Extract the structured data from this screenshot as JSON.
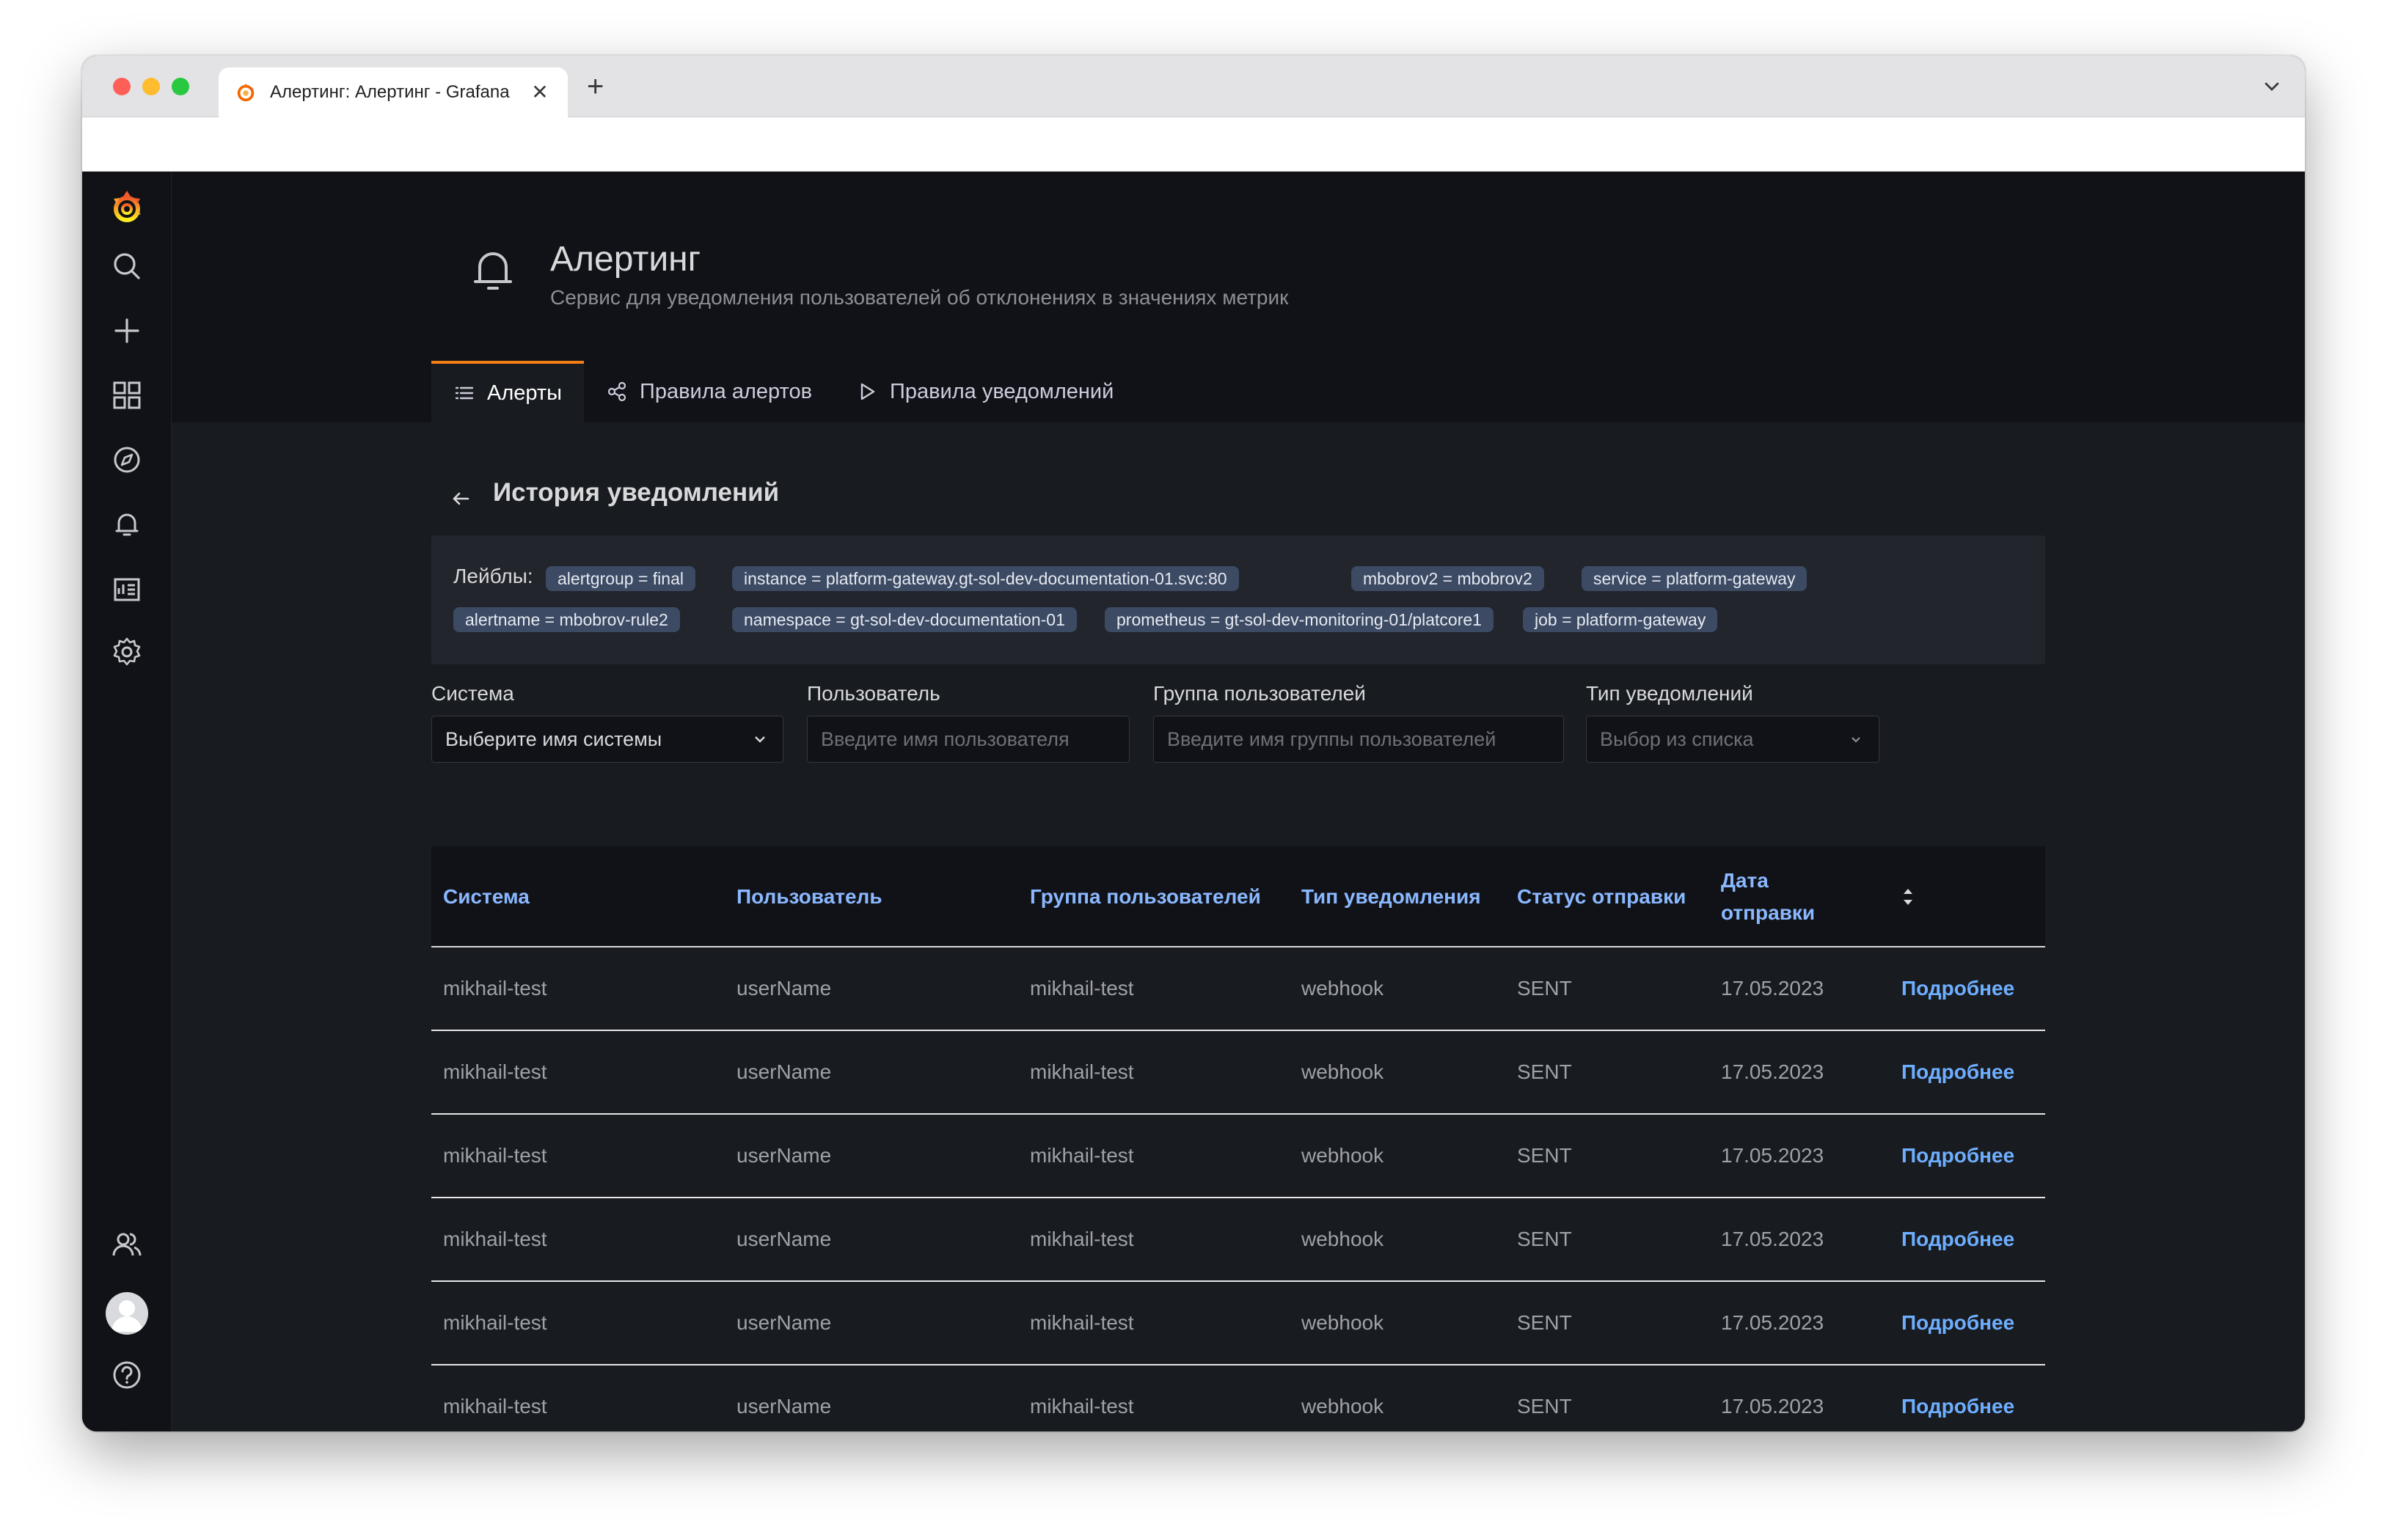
{
  "browser": {
    "tab_title": "Алертинг: Алертинг - Grafana",
    "close_glyph": "✕",
    "new_tab_glyph": "+"
  },
  "sidebar": {
    "icons": [
      "search-icon",
      "plus-icon",
      "dashboards-icon",
      "explore-icon",
      "alert-bell-icon",
      "reports-icon",
      "gear-icon",
      "users-icon",
      "avatar",
      "help-icon"
    ]
  },
  "header": {
    "title": "Алертинг",
    "subtitle": "Сервис для уведомления пользователей об отклонениях в значениях метрик"
  },
  "tabs": [
    {
      "label": "Алерты",
      "icon": "list-icon",
      "active": true
    },
    {
      "label": "Правила алертов",
      "icon": "share-nodes-icon",
      "active": false
    },
    {
      "label": "Правила уведомлений",
      "icon": "play-icon",
      "active": false
    }
  ],
  "section": {
    "back_glyph": "←",
    "title": "История уведомлений"
  },
  "labels": {
    "caption": "Лейблы:",
    "chips": [
      "alertgroup = final",
      "instance = platform-gateway.gt-sol-dev-documentation-01.svc:80",
      "mbobrov2 = mbobrov2",
      "service = platform-gateway",
      "alertname = mbobrov-rule2",
      "namespace = gt-sol-dev-documentation-01",
      "prometheus = gt-sol-dev-monitoring-01/platcore1",
      "job = platform-gateway"
    ]
  },
  "filters": {
    "system": {
      "label": "Система",
      "value": "Выберите имя системы"
    },
    "user": {
      "label": "Пользователь",
      "placeholder": "Введите имя пользователя"
    },
    "group": {
      "label": "Группа пользователей",
      "placeholder": "Введите имя группы пользователей"
    },
    "type": {
      "label": "Тип уведомлений",
      "value": "Выбор из списка"
    }
  },
  "table": {
    "columns": [
      "Система",
      "Пользователь",
      "Группа пользователей",
      "Тип уведомления",
      "Статус отправки",
      "Дата отправки"
    ],
    "link_label": "Подробнее",
    "rows": [
      [
        "mikhail-test",
        "userName",
        "mikhail-test",
        "webhook",
        "SENT",
        "17.05.2023"
      ],
      [
        "mikhail-test",
        "userName",
        "mikhail-test",
        "webhook",
        "SENT",
        "17.05.2023"
      ],
      [
        "mikhail-test",
        "userName",
        "mikhail-test",
        "webhook",
        "SENT",
        "17.05.2023"
      ],
      [
        "mikhail-test",
        "userName",
        "mikhail-test",
        "webhook",
        "SENT",
        "17.05.2023"
      ],
      [
        "mikhail-test",
        "userName",
        "mikhail-test",
        "webhook",
        "SENT",
        "17.05.2023"
      ],
      [
        "mikhail-test",
        "userName",
        "mikhail-test",
        "webhook",
        "SENT",
        "17.05.2023"
      ]
    ]
  },
  "colors": {
    "accent": "#f57f17",
    "link": "#6eaeff",
    "header_text": "#8ab8ff",
    "chip": "#3c4a64",
    "pager_active": "#3d71d9"
  }
}
